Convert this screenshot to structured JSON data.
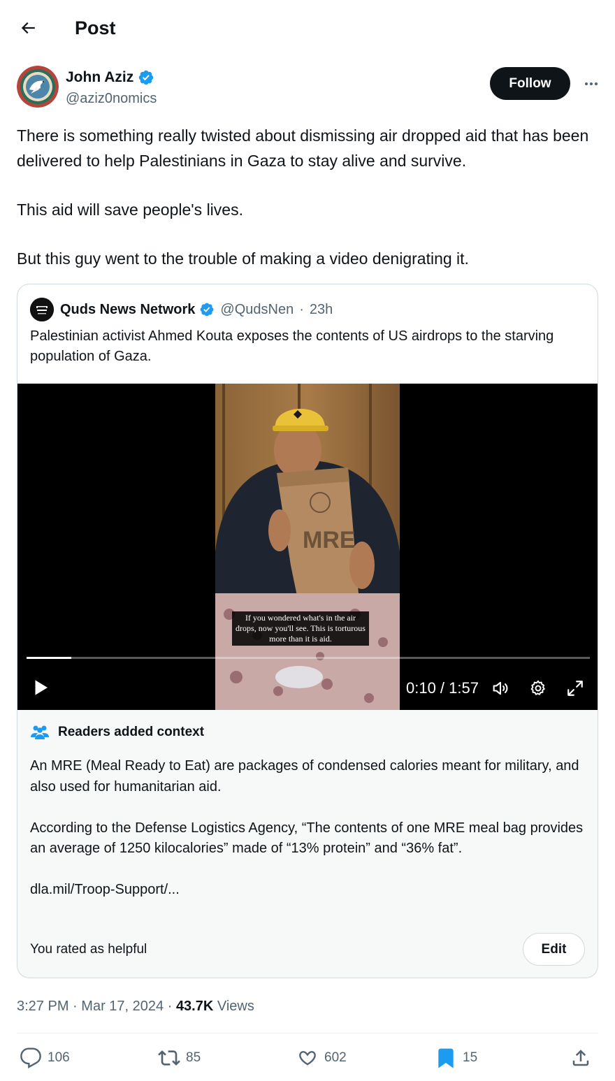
{
  "header": {
    "title": "Post",
    "back_icon": "back-arrow-icon"
  },
  "author": {
    "name": "John Aziz",
    "handle": "@aziz0nomics",
    "verified": true,
    "follow_label": "Follow",
    "more_icon": "more-dots-icon"
  },
  "tweet": {
    "paragraphs": [
      "There is something really twisted about dismissing air dropped aid that has been delivered to help Palestinians in Gaza to stay alive and survive.",
      "This aid will save people's lives.",
      "But this guy went to the trouble of making a video denigrating it."
    ]
  },
  "quote": {
    "name": "Quds News Network",
    "handle": "@QudsNen",
    "separator": "·",
    "time": "23h",
    "text": "Palestinian activist Ahmed Kouta exposes the contents of US airdrops to the starving population of Gaza.",
    "video": {
      "subtitle": "If you wondered what's in the air drops, now you'll see. This is torturous more than it is aid.",
      "package_label": "MRE",
      "time_readout": "0:10 / 1:57",
      "progress": 0.08
    }
  },
  "context": {
    "title": "Readers added context",
    "paragraph1": "An MRE (Meal Ready to Eat) are packages of condensed calories meant for military, and also used for humanitarian aid.",
    "paragraph2": "According to the Defense Logistics Agency, “The contents of one MRE meal bag provides an average of 1250 kilocalories” made of “13% protein” and “36% fat”.",
    "link": "dla.mil/Troop-Support/...",
    "rated": "You rated as helpful",
    "edit_label": "Edit"
  },
  "meta": {
    "time": "3:27 PM",
    "separator": "·",
    "date": "Mar 17, 2024",
    "views_count": "43.7K",
    "views_label": "Views"
  },
  "actions": {
    "replies": "106",
    "reposts": "85",
    "likes": "602",
    "bookmarks": "15"
  },
  "colors": {
    "text": "#0f1419",
    "secondary": "#536471",
    "verified": "#1d9bf0",
    "border": "#cfd9de"
  }
}
